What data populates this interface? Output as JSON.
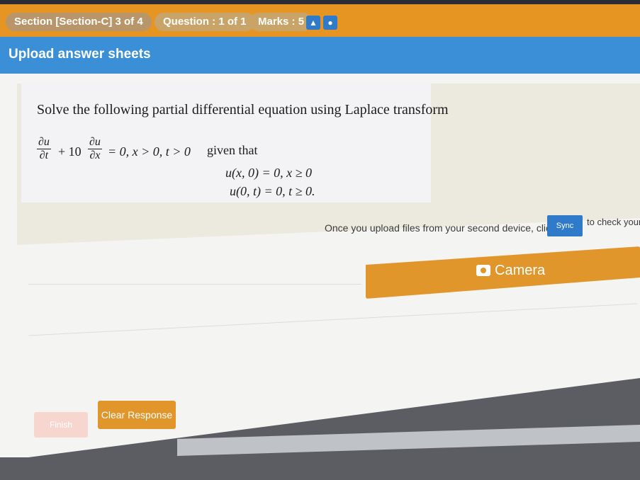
{
  "topbar": {
    "section": "Section [Section-C] 3 of 4",
    "question": "Question : 1 of 1",
    "marks": "Marks : 5",
    "icons": [
      "user-icon",
      "chat-icon"
    ]
  },
  "header": {
    "title": "Upload answer sheets"
  },
  "question": {
    "text": "Solve the following partial differential equation using Laplace transform",
    "frac1_num": "∂u",
    "frac1_den": "∂t",
    "plus10": "+ 10",
    "frac2_num": "∂u",
    "frac2_den": "∂x",
    "eq_tail": "= 0, x > 0, t > 0",
    "given": "given that",
    "cond1": "u(x, 0) = 0, x ≥ 0",
    "cond2": "u(0, t) = 0, t ≥ 0."
  },
  "upload": {
    "note": "Once you upload files from your second device, click on",
    "sync_label": "Sync",
    "note_tail": "to check your s",
    "camera_label": "Camera"
  },
  "footer": {
    "finish_label": "Finish",
    "clear_label": "Clear Response"
  },
  "colors": {
    "orange": "#e69522",
    "blue": "#3a8fd6",
    "button_orange": "#e0962b"
  }
}
